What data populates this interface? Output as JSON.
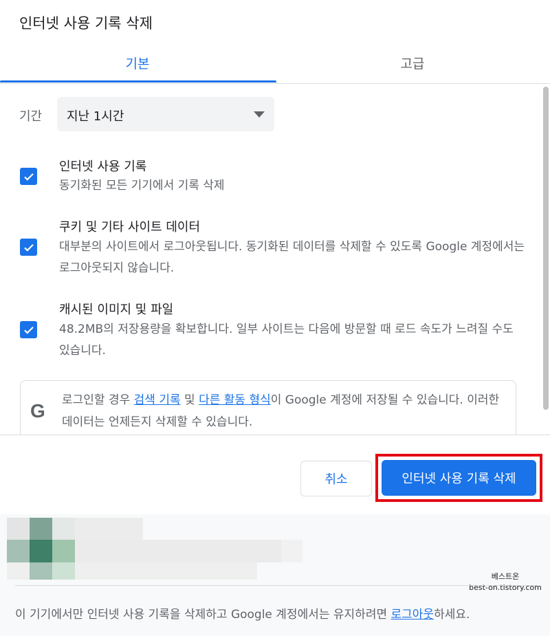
{
  "dialog": {
    "title": "인터넷 사용 기록 삭제",
    "tabs": [
      {
        "label": "기본",
        "active": true
      },
      {
        "label": "고급",
        "active": false
      }
    ]
  },
  "period": {
    "label": "기간",
    "value": "지난 1시간"
  },
  "options": [
    {
      "title": "인터넷 사용 기록",
      "desc": "동기화된 모든 기기에서 기록 삭제",
      "checked": true
    },
    {
      "title": "쿠키 및 기타 사이트 데이터",
      "desc": "대부분의 사이트에서 로그아웃됩니다. 동기화된 데이터를 삭제할 수 있도록 Google 계정에서는 로그아웃되지 않습니다.",
      "checked": true
    },
    {
      "title": "캐시된 이미지 및 파일",
      "desc": "48.2MB의 저장용량을 확보합니다. 일부 사이트는 다음에 방문할 때 로드 속도가 느려질 수도 있습니다.",
      "checked": true
    }
  ],
  "google_notice": {
    "prefix": "로그인할 경우 ",
    "link1": "검색 기록",
    "middle": " 및 ",
    "link2": "다른 활동 형식",
    "suffix": "이 Google 계정에 저장될 수 있습니다. 이러한 데이터는 언제든지 삭제할 수 있습니다."
  },
  "buttons": {
    "cancel": "취소",
    "delete": "인터넷 사용 기록 삭제"
  },
  "footer": {
    "watermark_line1": "베스트온",
    "watermark_line2": "best-on.tistory.com",
    "text_prefix": "이 기기에서만 인터넷 사용 기록을 삭제하고 Google 계정에서는 유지하려면 ",
    "link": "로그아웃",
    "text_suffix": "하세요."
  },
  "colors": {
    "accent": "#1a73e8",
    "highlight": "#e50914"
  }
}
